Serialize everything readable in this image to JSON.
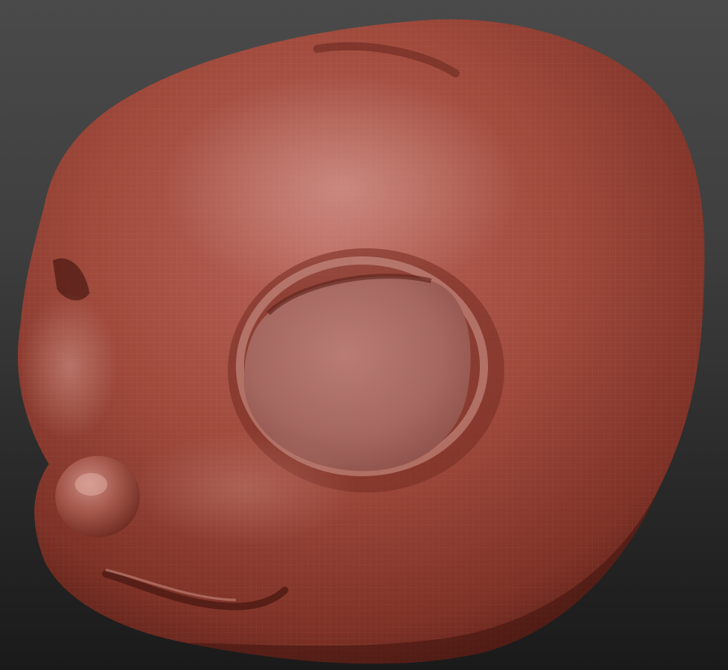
{
  "scene": {
    "subject": "sculpted-head",
    "material_color": "#a04a3c",
    "highlight_color": "#c98a80",
    "shadow_color": "#4a1812",
    "background_top": "#4a4a4a",
    "background_bottom": "#1a1a1a"
  }
}
